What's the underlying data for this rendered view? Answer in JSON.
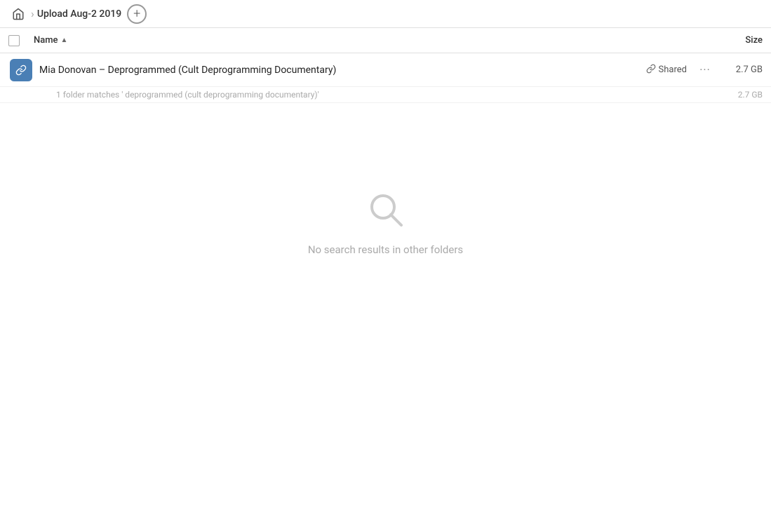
{
  "header": {
    "home_label": "Home",
    "breadcrumb_label": "Upload Aug-2 2019",
    "add_btn_label": "+"
  },
  "table": {
    "checkbox_col": "",
    "name_col_header": "Name",
    "sort_indicator": "▲",
    "size_col_header": "Size"
  },
  "file_row": {
    "name": "Mia Donovan – Deprogrammed (Cult Deprogramming Documentary)",
    "shared_label": "Shared",
    "size": "2.7 GB",
    "more_icon": "···"
  },
  "match_row": {
    "text": "1 folder matches ' deprogrammed (cult deprogramming documentary)'",
    "size": "2.7 GB"
  },
  "empty_state": {
    "message": "No search results in other folders"
  },
  "icons": {
    "home": "🏠",
    "link": "🔗",
    "file": "📄"
  }
}
